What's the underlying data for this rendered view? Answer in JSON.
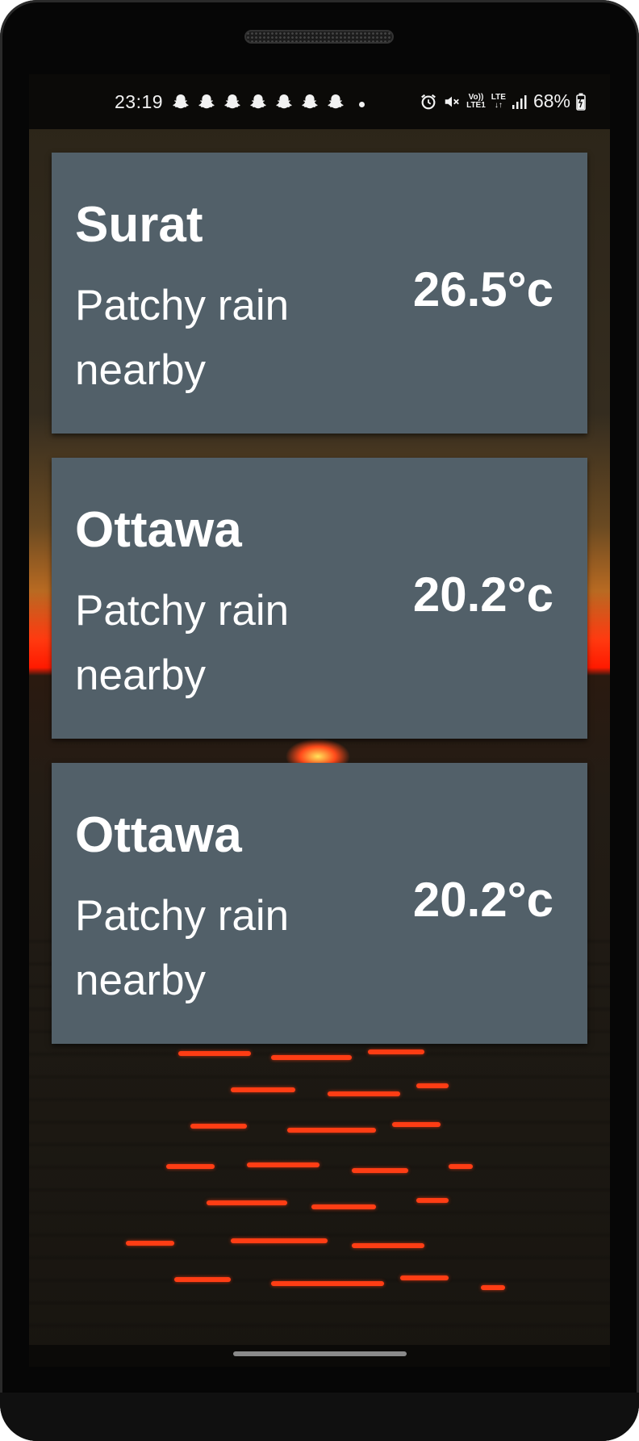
{
  "status_bar": {
    "time": "23:19",
    "notification_icons": [
      "snapchat-icon",
      "snapchat-icon",
      "snapchat-icon",
      "snapchat-icon",
      "snapchat-icon",
      "snapchat-icon",
      "snapchat-icon"
    ],
    "volte_label": "Vo))",
    "lte1_label": "LTE1",
    "lte_label": "LTE",
    "battery_percent": "68%"
  },
  "weather_cards": [
    {
      "city": "Surat",
      "condition": "Patchy rain nearby",
      "temperature": "26.5°c"
    },
    {
      "city": "Ottawa",
      "condition": "Patchy rain nearby",
      "temperature": "20.2°c"
    },
    {
      "city": "Ottawa",
      "condition": "Patchy rain nearby",
      "temperature": "20.2°c"
    }
  ],
  "colors": {
    "card_background": "#526069",
    "card_text": "#ffffff",
    "status_bar_background": "#0b0a08"
  }
}
